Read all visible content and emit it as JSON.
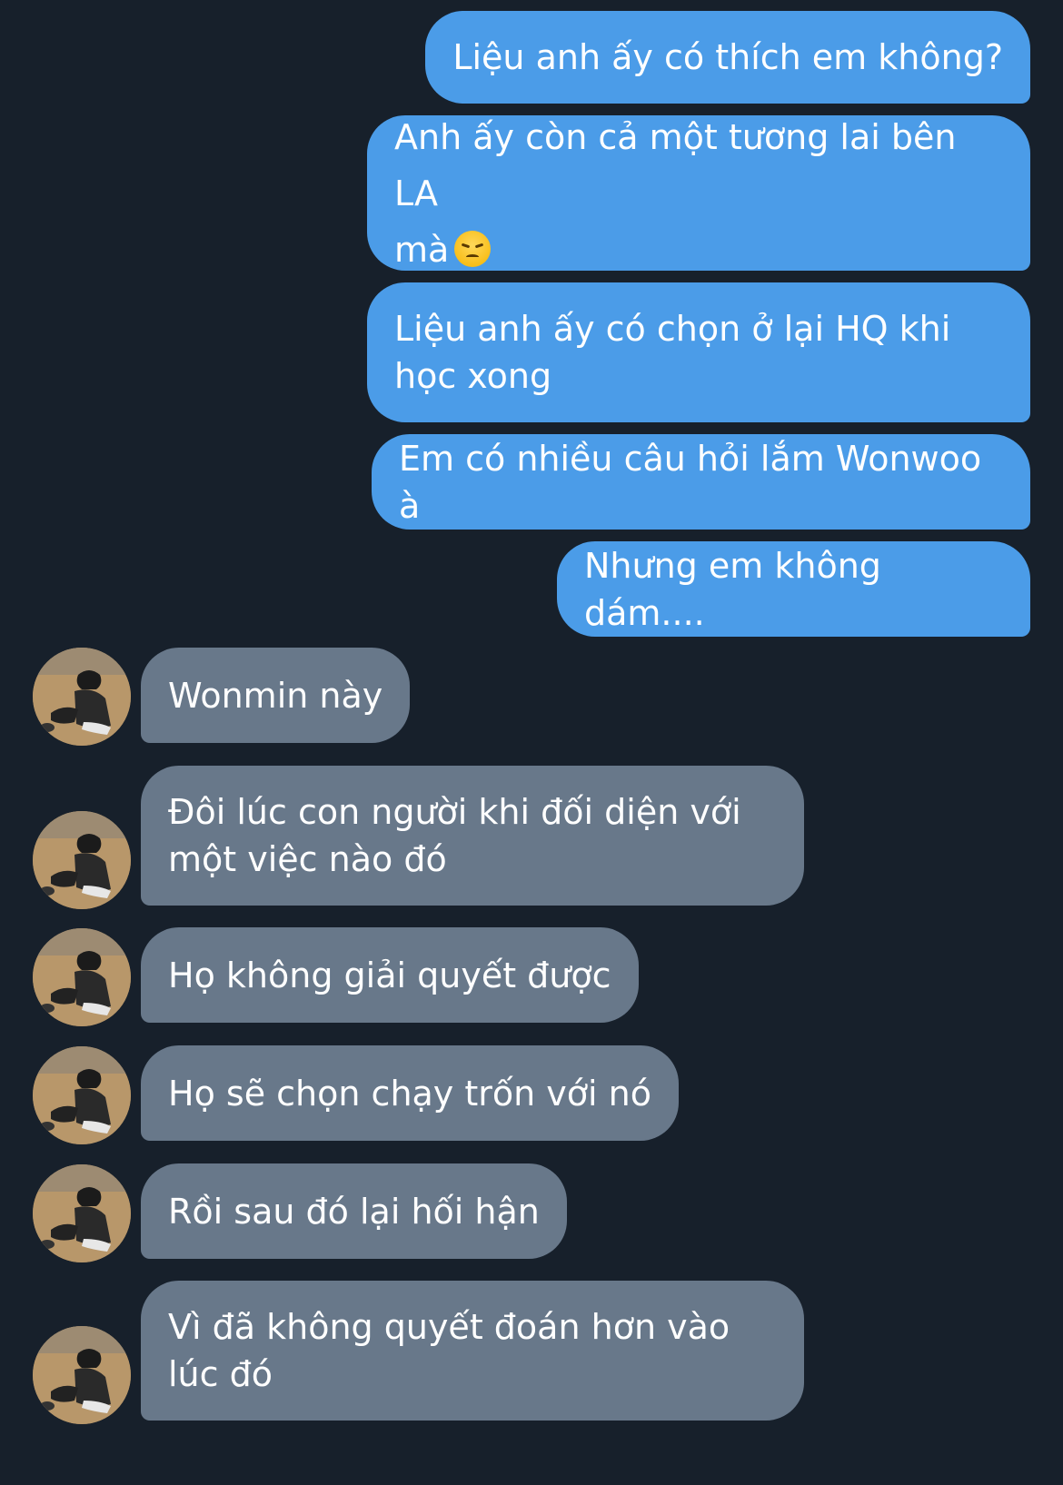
{
  "theme": {
    "background": "#17202b",
    "outgoing_bubble": "#4b9ce8",
    "incoming_bubble": "#68788a",
    "text": "#ffffff"
  },
  "messages": [
    {
      "direction": "outgoing",
      "text": "Liệu anh ấy có thích em không?"
    },
    {
      "direction": "outgoing",
      "text": "Anh ấy còn cả một tương lai bên LA\nmà",
      "emoji": "disappointed-face"
    },
    {
      "direction": "outgoing",
      "text": "Liệu anh ấy có chọn ở lại HQ khi\nhọc xong"
    },
    {
      "direction": "outgoing",
      "text": "Em có nhiều câu hỏi lắm Wonwoo à"
    },
    {
      "direction": "outgoing",
      "text": "Nhưng em không dám...."
    },
    {
      "direction": "incoming",
      "text": "Wonmin này",
      "avatar": "user-avatar"
    },
    {
      "direction": "incoming",
      "text": "Đôi lúc con người khi đối diện với\nmột việc nào đó",
      "avatar": "user-avatar"
    },
    {
      "direction": "incoming",
      "text": "Họ không giải quyết được",
      "avatar": "user-avatar"
    },
    {
      "direction": "incoming",
      "text": "Họ sẽ chọn chạy trốn với nó",
      "avatar": "user-avatar"
    },
    {
      "direction": "incoming",
      "text": "Rồi sau đó lại hối hận",
      "avatar": "user-avatar"
    },
    {
      "direction": "incoming",
      "text": "Vì đã không quyết đoán hơn vào\nlúc đó",
      "avatar": "user-avatar"
    }
  ]
}
